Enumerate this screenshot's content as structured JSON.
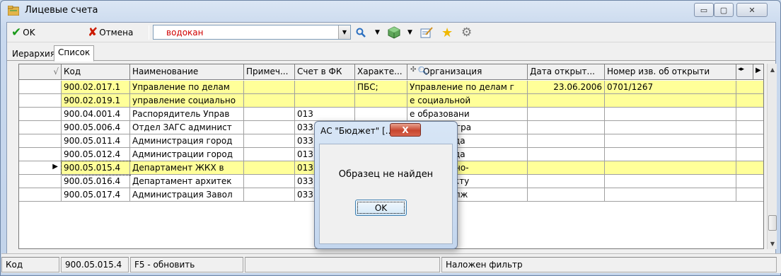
{
  "window": {
    "title": "Лицевые счета",
    "minimize": "▭",
    "maximize": "▢",
    "close": "✕"
  },
  "toolbar": {
    "ok_label": "OK",
    "cancel_label": "Отмена",
    "filter_value": "водокан",
    "icons": [
      "check-icon",
      "cross-icon",
      "search-icon",
      "dropdown-arrow-icon",
      "cube-icon",
      "dropdown-arrow-icon",
      "edit-icon",
      "star-icon",
      "gear-icon"
    ]
  },
  "tabs": [
    {
      "label": "Иерархия"
    },
    {
      "label": "Список"
    }
  ],
  "grid": {
    "columns": [
      "Код",
      "Наименование",
      "Примеч...",
      "Счет в ФК",
      "Характе...",
      "Организация",
      "Дата открыт...",
      "Номер изв. об открыти"
    ],
    "rows": [
      {
        "code": "900.02.017.1",
        "name": "Управление по делам",
        "note": "",
        "account": "",
        "type": "ПБС;",
        "org": "Управление по делам г",
        "date": "23.06.2006",
        "num": "0701/1267",
        "highlight": true,
        "current": false
      },
      {
        "code": "900.02.019.1",
        "name": "управление социально",
        "note": "",
        "account": "",
        "type": "",
        "org": "е социальной",
        "date": "",
        "num": "",
        "highlight": true,
        "current": false
      },
      {
        "code": "900.04.001.4",
        "name": "Распорядитель Управ",
        "note": "",
        "account": "013",
        "type": "",
        "org": "е образовани",
        "date": "",
        "num": "",
        "highlight": false,
        "current": false
      },
      {
        "code": "900.05.006.4",
        "name": "Отдел ЗАГС админист",
        "note": "",
        "account": "033",
        "type": "",
        "org": "иси актов гра",
        "date": "",
        "num": "",
        "highlight": false,
        "current": false
      },
      {
        "code": "900.05.011.4",
        "name": "Администрация город",
        "note": "",
        "account": "033",
        "type": "",
        "org": "ация города",
        "date": "",
        "num": "",
        "highlight": false,
        "current": false
      },
      {
        "code": "900.05.012.4",
        "name": "Администрации город",
        "note": "",
        "account": "013",
        "type": "",
        "org": "ация города",
        "date": "",
        "num": "",
        "highlight": false,
        "current": false
      },
      {
        "code": "900.05.015.4",
        "name": "Департамент ЖКХ в",
        "note": "",
        "account": "013",
        "type": "",
        "org": "нт жилищно-",
        "date": "",
        "num": "",
        "highlight": true,
        "current": true
      },
      {
        "code": "900.05.016.4",
        "name": "Департамент архитек",
        "note": "",
        "account": "033",
        "type": "",
        "org": "нт архитекту",
        "date": "",
        "num": "",
        "highlight": false,
        "current": false
      },
      {
        "code": "900.05.017.4",
        "name": "Администрация Завол",
        "note": "",
        "account": "033",
        "type": "",
        "org": "ация Заволж",
        "date": "",
        "num": "",
        "highlight": false,
        "current": false
      }
    ]
  },
  "statusbar": {
    "field": "Код",
    "value": "900.05.015.4",
    "hint": "F5 - обновить",
    "filter": "Наложен фильтр"
  },
  "dialog": {
    "title": "АС \"Бюджет\" [...",
    "message": "Образец не найден",
    "ok_label": "OK",
    "close": "X"
  },
  "colors": {
    "highlight_row": "#ffff99",
    "filter_text": "#d00000",
    "dialog_close": "#c7462f"
  }
}
